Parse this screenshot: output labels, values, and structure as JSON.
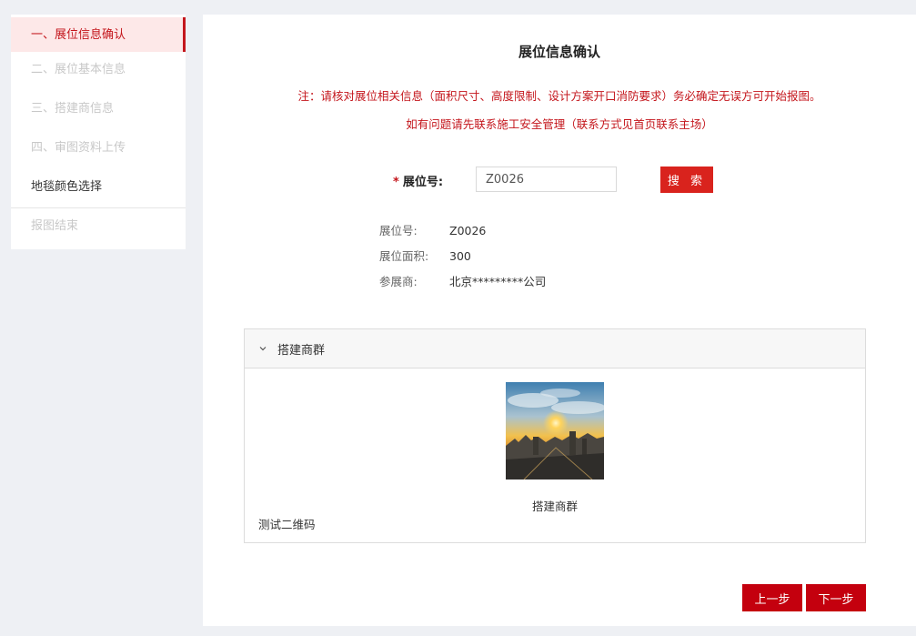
{
  "sidebar": {
    "items": [
      {
        "label": "一、展位信息确认"
      },
      {
        "label": "二、展位基本信息"
      },
      {
        "label": "三、搭建商信息"
      },
      {
        "label": "四、审图资料上传"
      },
      {
        "label": "地毯颜色选择"
      },
      {
        "label": "报图结束"
      }
    ]
  },
  "main": {
    "title": "展位信息确认",
    "notice_line1": "注：请核对展位相关信息（面积尺寸、高度限制、设计方案开口消防要求）务必确定无误方可开始报图。",
    "notice_line2": "如有问题请先联系施工安全管理（联系方式见首页联系主场）",
    "search": {
      "required_mark": "*",
      "label": "展位号:",
      "value": "Z0026",
      "button": "搜 索"
    },
    "info": {
      "booth_no_label": "展位号:",
      "booth_no": "Z0026",
      "area_label": "展位面积:",
      "area": "300",
      "exhibitor_label": "参展商:",
      "exhibitor": "北京*********公司"
    },
    "panel": {
      "header": "搭建商群",
      "caption": "搭建商群",
      "qr_name": "测试二维码"
    },
    "prev_button": "上一步",
    "next_button": "下一步"
  },
  "colors": {
    "accent": "#c4161c",
    "button": "#d9231d",
    "background": "#eef0f4"
  }
}
